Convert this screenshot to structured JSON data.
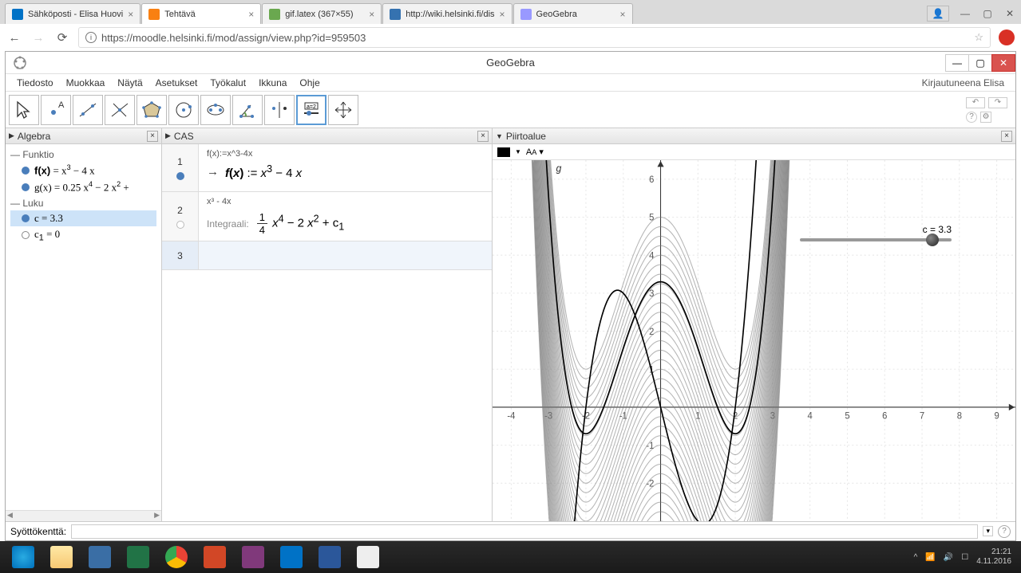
{
  "browser": {
    "tabs": [
      {
        "title": "Sähköposti - Elisa Huovi"
      },
      {
        "title": "Tehtävä"
      },
      {
        "title": "gif.latex (367×55)"
      },
      {
        "title": "http://wiki.helsinki.fi/dis"
      },
      {
        "title": "GeoGebra"
      }
    ],
    "url": "https://moodle.helsinki.fi/mod/assign/view.php?id=959503"
  },
  "geogebra": {
    "title": "GeoGebra",
    "menus": [
      "Tiedosto",
      "Muokkaa",
      "Näytä",
      "Asetukset",
      "Työkalut",
      "Ikkuna",
      "Ohje"
    ],
    "user_status": "Kirjautuneena Elisa",
    "panels": {
      "algebra": {
        "title": "Algebra",
        "groups": [
          {
            "name": "Funktio",
            "items": [
              {
                "label_html": "f(x) = x³ − 4 x",
                "dot": "blue"
              },
              {
                "label_html": "g(x) = 0.25 x⁴ − 2 x² +",
                "dot": "blue"
              }
            ]
          },
          {
            "name": "Luku",
            "items": [
              {
                "label_html": "c = 3.3",
                "dot": "blue",
                "selected": true
              },
              {
                "label_html": "c₁ = 0",
                "dot": "hollow"
              }
            ]
          }
        ]
      },
      "cas": {
        "title": "CAS",
        "rows": [
          {
            "n": "1",
            "input": "f(x):=x^3-4x",
            "output_prefix": "→",
            "output": "f(x) := x³ − 4 x",
            "dot": "blue"
          },
          {
            "n": "2",
            "input": "x³ - 4x",
            "output_label": "Integraali:",
            "output_frac": {
              "num": "1",
              "den": "4"
            },
            "output_rest": " x⁴ − 2 x² + c₁",
            "dot": "hollow"
          },
          {
            "n": "3",
            "input": "",
            "selected": true
          }
        ]
      },
      "graphics": {
        "title": "Piirtoalue",
        "slider": {
          "label": "c = 3.3",
          "pos_pct": 83
        }
      }
    },
    "input_label": "Syöttökenttä:"
  },
  "systray": {
    "time": "21:21",
    "date": "4.11.2016"
  },
  "chart_data": {
    "type": "line",
    "title": "",
    "xlabel": "",
    "ylabel": "",
    "xlim": [
      -4.5,
      9.5
    ],
    "ylim": [
      -3,
      6.5
    ],
    "xticks": [
      -4,
      -3,
      -2,
      -1,
      0,
      1,
      2,
      3,
      4,
      5,
      6,
      7,
      8,
      9
    ],
    "yticks": [
      -2,
      -1,
      1,
      2,
      3,
      4,
      5,
      6
    ],
    "series": [
      {
        "name": "f(x) = x^3 - 4x",
        "formula": "x^3 - 4*x"
      },
      {
        "name": "g(x) = 0.25 x^4 - 2 x^2 + c (family, c ≈ -5..5, trace on)",
        "formula": "0.25*x^4 - 2*x^2 + c"
      },
      {
        "name": "g(x) current (c = 3.3)",
        "formula": "0.25*x^4 - 2*x^2 + 3.3"
      }
    ],
    "parameters": {
      "c": 3.3,
      "c1": 0
    }
  }
}
